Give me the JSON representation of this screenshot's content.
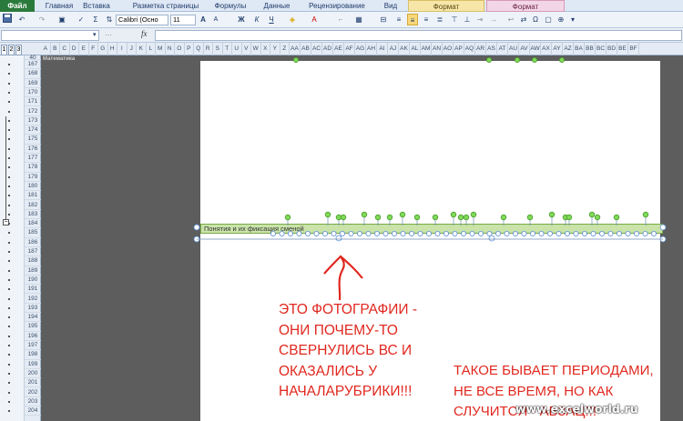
{
  "ribbon": {
    "tabs": [
      "Файл",
      "Главная",
      "Вставка",
      "Разметка страницы",
      "Формулы",
      "Данные",
      "Рецензирование",
      "Вид",
      "Формат",
      "Формат"
    ]
  },
  "toolbar": {
    "font_name": "Calibri (Осно",
    "font_size": "11",
    "bold": "Ж",
    "italic": "К",
    "underline": "Ч",
    "font_color": "А",
    "grow": "A",
    "shrink": "A",
    "sigma": "Σ",
    "omega": "Ω"
  },
  "formula_bar": {
    "fx": "fx",
    "name_box": "",
    "formula": ""
  },
  "outline_levels": [
    "1",
    "2",
    "3"
  ],
  "columns": [
    "A",
    "B",
    "C",
    "D",
    "E",
    "F",
    "G",
    "H",
    "I",
    "J",
    "K",
    "L",
    "M",
    "N",
    "O",
    "P",
    "Q",
    "R",
    "S",
    "T",
    "U",
    "V",
    "W",
    "X",
    "Y",
    "Z",
    "AA",
    "AB",
    "AC",
    "AD",
    "AE",
    "AF",
    "AG",
    "AH",
    "AI",
    "AJ",
    "AK",
    "AL",
    "AM",
    "AN",
    "AO",
    "AP",
    "AQ",
    "AR",
    "AS",
    "AT",
    "AU",
    "AV",
    "AW",
    "AX",
    "AY",
    "AZ",
    "BA",
    "BB",
    "BC",
    "BD",
    "BE",
    "BF"
  ],
  "rows": [
    "40",
    "167",
    "168",
    "169",
    "170",
    "171",
    "172",
    "173",
    "174",
    "175",
    "176",
    "177",
    "178",
    "179",
    "180",
    "181",
    "182",
    "183",
    "184",
    "185",
    "186",
    "187",
    "188",
    "189",
    "190",
    "191",
    "192",
    "193",
    "194",
    "195",
    "196",
    "197",
    "198",
    "199",
    "200",
    "201",
    "202",
    "203",
    "204"
  ],
  "sheet": {
    "row40_label": "Математика",
    "band_text": "Понятия и их фиксация сменой"
  },
  "annotations": {
    "left_lines": [
      "ЭТО ФОТОГРАФИИ -",
      "ОНИ ПОЧЕМУ-ТО",
      "СВЕРНУЛИСЬ ВС И",
      "ОКАЗАЛИСЬ У",
      "НАЧАЛАРУБРИКИ!!!"
    ],
    "right_lines": [
      "ТАКОЕ БЫВАЕТ ПЕРИОДАМИ,",
      "НЕ ВСЕ ВРЕМЯ, НО КАК",
      "СЛУЧИТСЯ - АБЗАЦ!!!"
    ],
    "color": "#e0281f"
  },
  "watermark": "www.excelworld.ru",
  "colors": {
    "accent_file": "#2a7a3b",
    "band_fill": "#c9e3a8",
    "handle_green": "#7ed957",
    "handle_blue": "#5b8fd6"
  }
}
